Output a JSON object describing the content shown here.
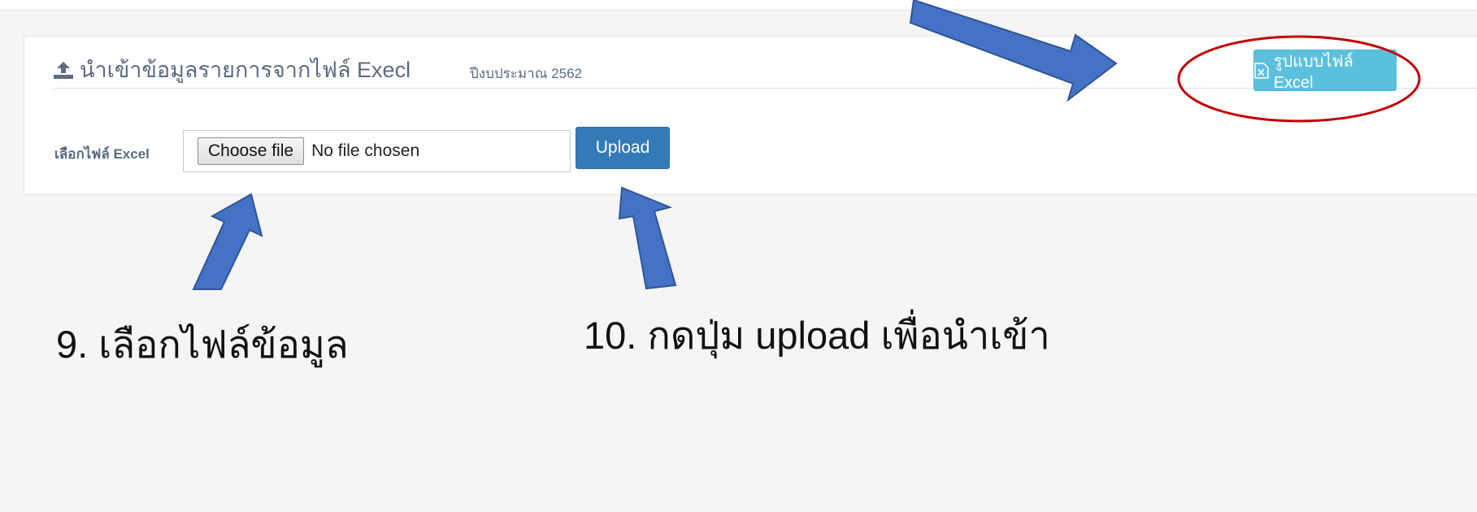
{
  "panel": {
    "title": "นำเข้าข้อมูลรายการจากไฟล์ Execl",
    "subtitle": "ปีงบประมาณ 2562",
    "heading_icon": "upload-icon",
    "template_button": {
      "label": "รูปแบบไฟล์ Excel",
      "icon": "excel-file-icon"
    }
  },
  "form": {
    "field_label": "เลือกไฟล์ Excel",
    "choose_button_label": "Choose file",
    "file_status": "No file chosen",
    "upload_button_label": "Upload"
  },
  "annotations": {
    "step9": "9. เลือกไฟล์ข้อมูล",
    "step10": "10. กดปุ่ม upload เพื่อนำเข้า"
  },
  "colors": {
    "page_background": "#f5f5f5",
    "heading_text": "#5b6b82",
    "info_button": "#5bc0de",
    "primary_button": "#337ab7",
    "arrow_fill": "#4472c4",
    "highlight_ellipse": "#c00000"
  }
}
